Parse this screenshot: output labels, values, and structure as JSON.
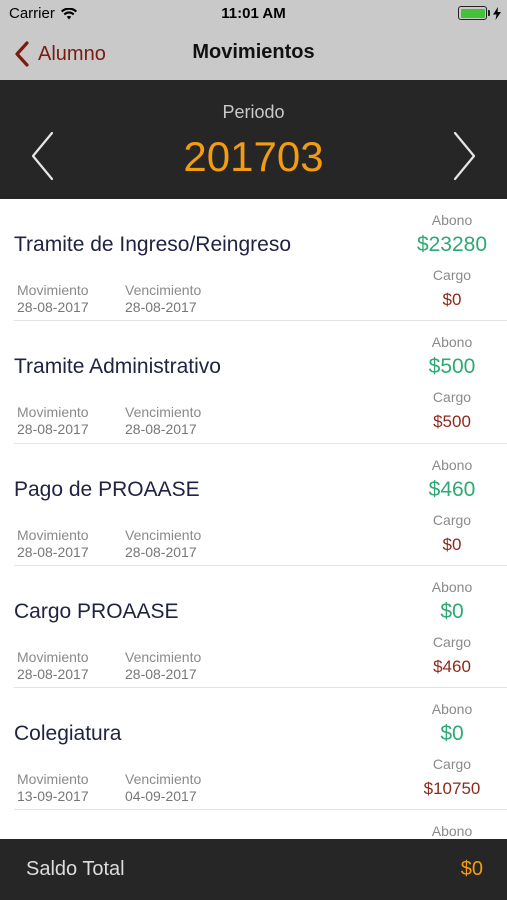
{
  "status_bar": {
    "carrier": "Carrier",
    "time": "11:01 AM",
    "battery_color": "#44c23a"
  },
  "nav": {
    "back_label": "Alumno",
    "title": "Movimientos",
    "accent_color": "#7a1c10"
  },
  "period": {
    "label": "Periodo",
    "value": "201703",
    "value_color": "#f39c12",
    "prev_icon": "chevron-left-icon",
    "next_icon": "chevron-right-icon"
  },
  "labels": {
    "abono": "Abono",
    "cargo": "Cargo",
    "movimiento": "Movimiento",
    "vencimiento": "Vencimiento"
  },
  "movements": [
    {
      "title": "Tramite de Ingreso/Reingreso",
      "movimiento": "28-08-2017",
      "vencimiento": "28-08-2017",
      "abono": "$23280",
      "cargo": "$0"
    },
    {
      "title": "Tramite Administrativo",
      "movimiento": "28-08-2017",
      "vencimiento": "28-08-2017",
      "abono": "$500",
      "cargo": "$500"
    },
    {
      "title": "Pago de PROAASE",
      "movimiento": "28-08-2017",
      "vencimiento": "28-08-2017",
      "abono": "$460",
      "cargo": "$0"
    },
    {
      "title": "Cargo PROAASE",
      "movimiento": "28-08-2017",
      "vencimiento": "28-08-2017",
      "abono": "$0",
      "cargo": "$460"
    },
    {
      "title": "Colegiatura",
      "movimiento": "13-09-2017",
      "vencimiento": "04-09-2017",
      "abono": "$0",
      "cargo": "$10750"
    }
  ],
  "colors": {
    "abono": "#2ea973",
    "cargo": "#8b2a1c"
  },
  "footer": {
    "label": "Saldo Total",
    "value": "$0"
  }
}
